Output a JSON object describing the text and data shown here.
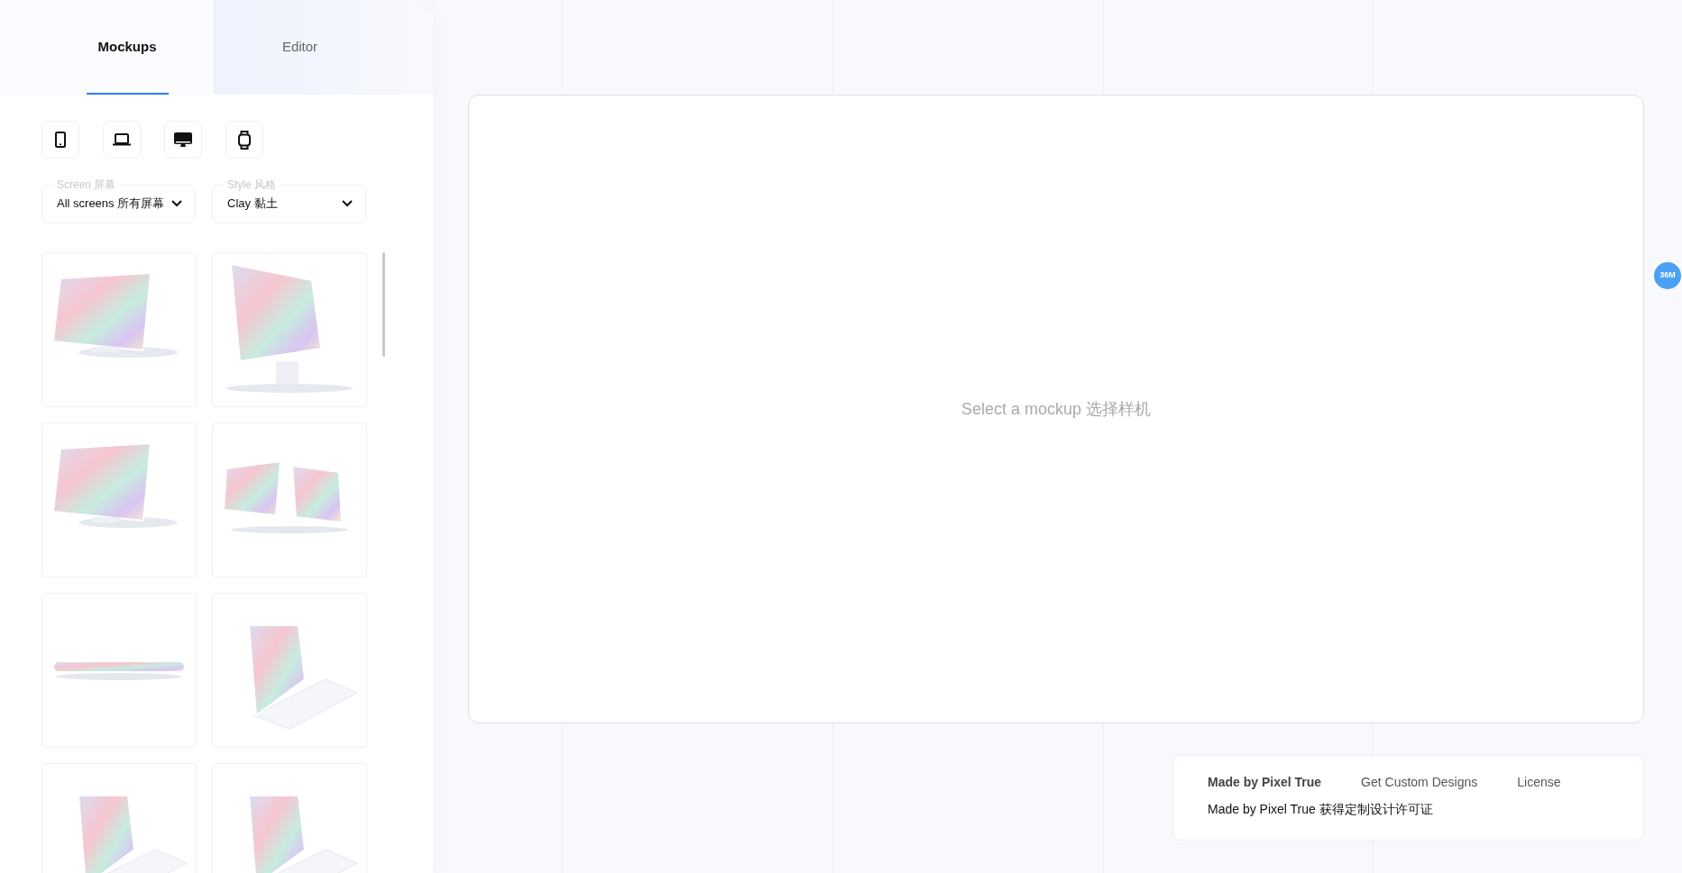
{
  "tabs": [
    {
      "label": "Mockups",
      "selected": true
    },
    {
      "label": "Editor",
      "selected": false
    }
  ],
  "device_filters": [
    {
      "kind": "phone"
    },
    {
      "kind": "laptop"
    },
    {
      "kind": "desktop"
    },
    {
      "kind": "watch"
    }
  ],
  "dropdowns": [
    {
      "label": "Screen 屏幕",
      "value": "All screens 所有屏幕"
    },
    {
      "label": "Style 风格",
      "value": "Clay 黏土"
    }
  ],
  "thumbnails": [
    {
      "kind": "monitor"
    },
    {
      "kind": "monitor-tall"
    },
    {
      "kind": "monitor"
    },
    {
      "kind": "dual-monitor"
    },
    {
      "kind": "flat"
    },
    {
      "kind": "laptop"
    },
    {
      "kind": "laptop"
    },
    {
      "kind": "laptop"
    }
  ],
  "canvas": {
    "placeholder_text": "Select a mockup 选择样机"
  },
  "badge": "36M",
  "footer": {
    "links": [
      {
        "label": "Made by Pixel True",
        "bold": true
      },
      {
        "label": "Get Custom Designs",
        "bold": false
      },
      {
        "label": "License",
        "bold": false
      }
    ],
    "line": "Made by Pixel True 获得定制设计许可证"
  }
}
